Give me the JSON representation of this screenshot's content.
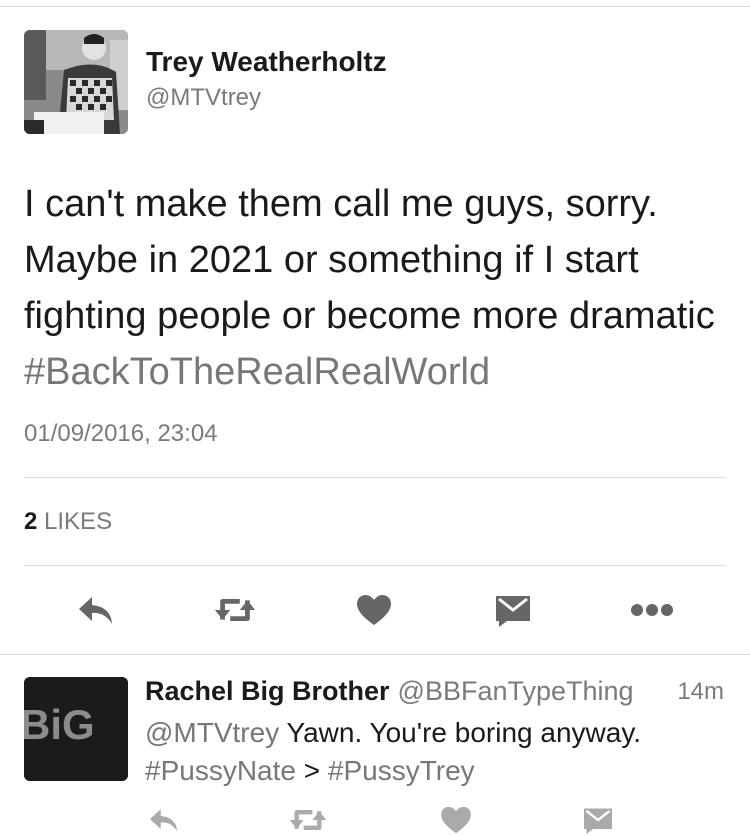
{
  "tweet": {
    "author_name": "Trey Weatherholtz",
    "author_handle": "@MTVtrey",
    "text_main": "I can't make them call me guys, sorry. Maybe in 2021 or something if I start fighting people or become more dramatic",
    "hashtag": "#BackToTheRealRealWorld",
    "timestamp": "01/09/2016, 23:04",
    "likes_count": "2",
    "likes_label": "LIKES",
    "actions": [
      "reply-icon",
      "retweet-icon",
      "like-icon",
      "message-icon",
      "more-icon"
    ]
  },
  "reply": {
    "avatar_text": "BiG",
    "author_name": "Rachel Big Brother",
    "author_handle": "@BBFanTypeThing",
    "time": "14m",
    "mention": "@MTVtrey",
    "text_main": "Yawn. You're boring anyway.",
    "tag1": "#PussyNate",
    "separator": ">",
    "tag2": "#PussyTrey",
    "actions": [
      "reply-icon",
      "retweet-icon",
      "like-icon",
      "message-icon"
    ]
  },
  "colors": {
    "text": "#1a1a1a",
    "secondary": "#7a7a7a",
    "icon": "#666666",
    "icon_light": "#aaaaaa",
    "divider": "#dcdcdc"
  }
}
